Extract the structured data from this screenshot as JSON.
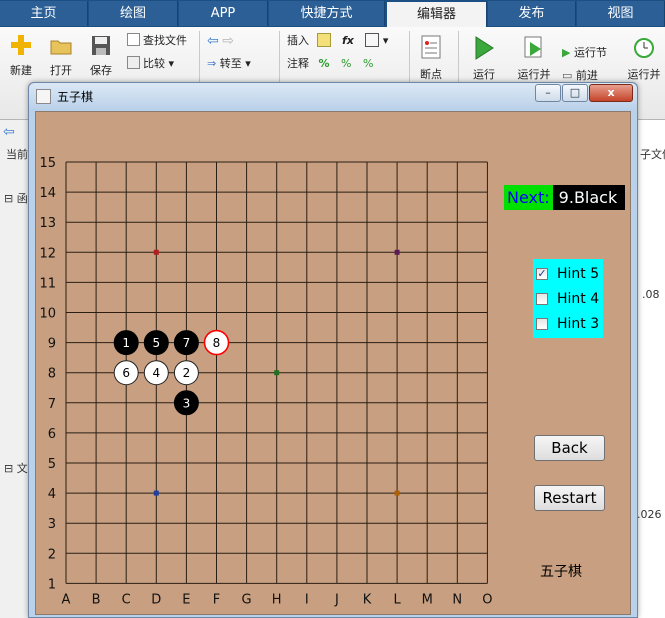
{
  "ribbon": {
    "tabs": [
      "主页",
      "绘图",
      "APP",
      "快捷方式",
      "编辑器",
      "发布",
      "视图"
    ],
    "active_tab": "编辑器",
    "buttons": {
      "new": "新建",
      "open": "打开",
      "save": "保存",
      "find_files": "查找文件",
      "compare": "比较",
      "goto": "转至",
      "insert": "插入",
      "comment": "注释",
      "breakpoints": "断点",
      "run": "运行",
      "run_advance": "运行并",
      "run_section": "运行节",
      "advance": "前进",
      "run_time": "运行并"
    }
  },
  "background": {
    "left_current": "当前",
    "left_func": "函",
    "left_file": "文",
    "right_file": "子文件",
    "right_num1": ".08",
    "right_num2": ".026"
  },
  "window": {
    "title": "五子棋",
    "minimize": "–",
    "restore": "□",
    "close": "x"
  },
  "game": {
    "next_label": "Next:",
    "next_value": "9.Black",
    "hints": [
      {
        "label": "Hint 5",
        "checked": true
      },
      {
        "label": "Hint 4",
        "checked": false
      },
      {
        "label": "Hint 3",
        "checked": false
      }
    ],
    "back_label": "Back",
    "restart_label": "Restart",
    "figure_label": "五子棋",
    "colors": {
      "board": "#c8a081",
      "next_label_bg": "#00e000",
      "next_label_fg": "#0000ff",
      "hint_bg": "#00ffff",
      "last_move_ring": "#ff0000"
    },
    "board": {
      "columns": [
        "A",
        "B",
        "C",
        "D",
        "E",
        "F",
        "G",
        "H",
        "I",
        "J",
        "K",
        "L",
        "M",
        "N",
        "O"
      ],
      "rows": [
        "1",
        "2",
        "3",
        "4",
        "5",
        "6",
        "7",
        "8",
        "9",
        "10",
        "11",
        "12",
        "13",
        "14",
        "15"
      ],
      "star_points": [
        {
          "col": "D",
          "row": 12,
          "color": "#b02020"
        },
        {
          "col": "L",
          "row": 12,
          "color": "#5a1a5a"
        },
        {
          "col": "H",
          "row": 8,
          "color": "#207020"
        },
        {
          "col": "D",
          "row": 4,
          "color": "#2040a0"
        },
        {
          "col": "L",
          "row": 4,
          "color": "#b06000"
        }
      ],
      "stones": [
        {
          "n": "1",
          "color": "black",
          "col": "C",
          "row": 9
        },
        {
          "n": "2",
          "color": "white",
          "col": "E",
          "row": 8
        },
        {
          "n": "3",
          "color": "black",
          "col": "E",
          "row": 7
        },
        {
          "n": "4",
          "color": "white",
          "col": "D",
          "row": 8
        },
        {
          "n": "5",
          "color": "black",
          "col": "D",
          "row": 9
        },
        {
          "n": "6",
          "color": "white",
          "col": "C",
          "row": 8
        },
        {
          "n": "7",
          "color": "black",
          "col": "E",
          "row": 9
        },
        {
          "n": "8",
          "color": "white",
          "col": "F",
          "row": 9,
          "last": true
        }
      ]
    }
  }
}
